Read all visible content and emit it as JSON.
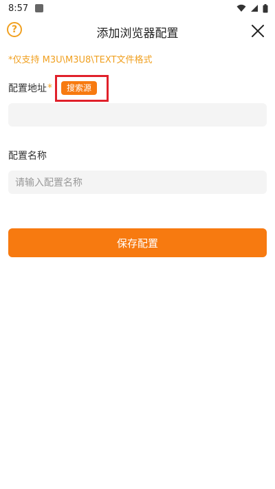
{
  "status_bar": {
    "time": "8:57"
  },
  "header": {
    "title": "添加浏览器配置",
    "help_icon": "?"
  },
  "notice": "*仅支持 M3U\\M3U8\\TEXT文件格式",
  "form": {
    "address": {
      "label": "配置地址",
      "required_mark": "*",
      "search_button_label": "搜索源",
      "value": ""
    },
    "name": {
      "label": "配置名称",
      "placeholder": "请输入配置名称"
    }
  },
  "save_button_label": "保存配置",
  "colors": {
    "accent": "#f77a10",
    "notice": "#f0a020",
    "highlight": "#e0202a",
    "input_bg": "#f4f4f4"
  }
}
